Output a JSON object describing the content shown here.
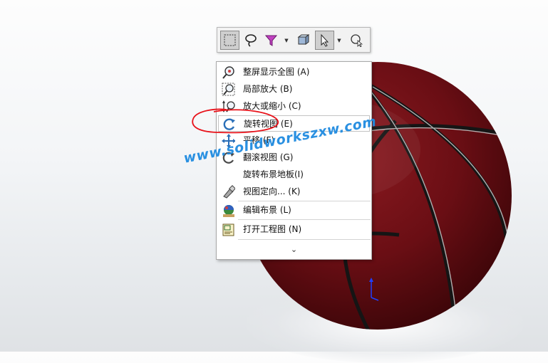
{
  "toolbar": {
    "buttons": [
      {
        "id": "box-select",
        "icon": "dotted-rectangle-icon"
      },
      {
        "id": "lasso-select",
        "icon": "lasso-icon"
      },
      {
        "id": "selection-filter",
        "icon": "filter-funnel-icon"
      },
      {
        "id": "section-view",
        "icon": "cube-section-icon"
      },
      {
        "id": "select-pointer",
        "icon": "pointer-arrow-icon"
      },
      {
        "id": "magnifying-selection",
        "icon": "magnifier-cursor-icon"
      }
    ]
  },
  "menu": {
    "items": [
      {
        "label": "整屏显示全图 (A)",
        "icon": "zoom-to-fit-icon"
      },
      {
        "label": "局部放大 (B)",
        "icon": "zoom-to-area-icon"
      },
      {
        "label": "放大或缩小 (C)",
        "icon": "zoom-in-out-icon"
      },
      {
        "label": "旋转视图 (E)",
        "icon": "rotate-view-icon"
      },
      {
        "label": "平移 (F)",
        "icon": "pan-icon"
      },
      {
        "label": "翻滚视图 (G)",
        "icon": "roll-view-icon"
      },
      {
        "label": "旋转布景地板(I)",
        "icon": ""
      },
      {
        "label": "视图定向... (K)",
        "icon": "view-orientation-icon"
      },
      {
        "label": "编辑布景 (L)",
        "icon": "edit-scene-icon"
      },
      {
        "label": "打开工程图 (N)",
        "icon": "open-drawing-icon"
      }
    ],
    "expand_glyph": "⌄"
  },
  "watermark": "www.solidworkszxw.com",
  "colors": {
    "ball": "#6e0f14",
    "ball_seam": "#1a1a1a",
    "annotation": "#e8121a",
    "watermark": "#1f8be0"
  }
}
